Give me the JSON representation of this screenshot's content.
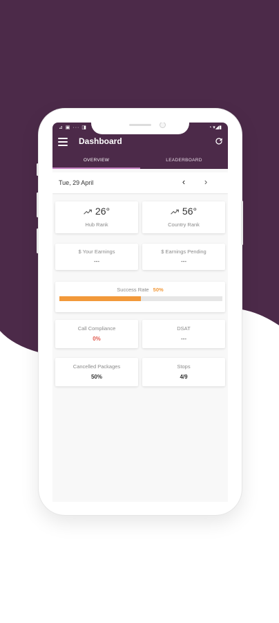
{
  "app": {
    "title": "Dashboard",
    "status_left": "⊿ ▣ ··· ◨",
    "status_right": "◔ ▾◢▮"
  },
  "tabs": [
    {
      "label": "OVERVIEW",
      "active": true
    },
    {
      "label": "LEADERBOARD",
      "active": false
    }
  ],
  "date": {
    "label": "Tue, 29 April",
    "prev": "‹",
    "next": "›"
  },
  "ranks": [
    {
      "value": "26°",
      "label": "Hub Rank"
    },
    {
      "value": "56°",
      "label": "Country Rank"
    }
  ],
  "earnings": [
    {
      "label": "$ Your Earnings",
      "value": "---"
    },
    {
      "label": "$ Earnings Pending",
      "value": "---"
    }
  ],
  "success": {
    "label": "Success Rate",
    "value": "50%",
    "fraction": 0.5
  },
  "metrics": [
    {
      "label": "Call Compliance",
      "value": "0%",
      "color": "#e05a4e"
    },
    {
      "label": "DSAT",
      "value": "---",
      "color": "#333333"
    },
    {
      "label": "Cancelled Packages",
      "value": "50%",
      "color": "#333333"
    },
    {
      "label": "Stops",
      "value": "4/9",
      "color": "#333333"
    }
  ],
  "colors": {
    "brand": "#4c2a49",
    "accent": "#f2993a",
    "tab_indicator": "#c27fc0",
    "error": "#e05a4e"
  }
}
